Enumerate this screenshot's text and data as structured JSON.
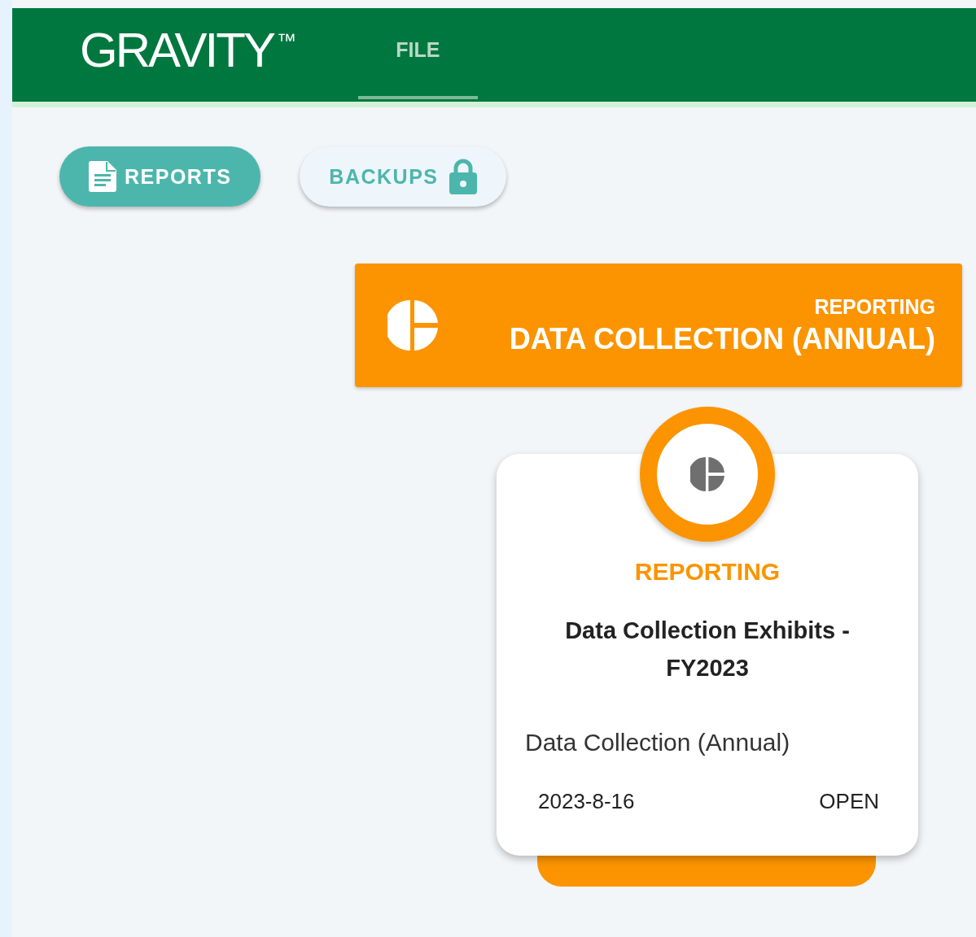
{
  "header": {
    "logo": "GRAVITY",
    "trademark": "™",
    "tabs": [
      {
        "label": "FILE",
        "selected": true
      }
    ]
  },
  "nav_buttons": [
    {
      "label": "REPORTS",
      "selected": true,
      "locked": false
    },
    {
      "label": "BACKUPS",
      "selected": false,
      "locked": true
    }
  ],
  "banner": {
    "category": "REPORTING",
    "title": "DATA COLLECTION (ANNUAL)"
  },
  "card": {
    "category": "REPORTING",
    "title": "Data Collection Exhibits - FY2023",
    "subtitle": "Data Collection (Annual)",
    "date": "2023-8-16",
    "status": "OPEN"
  }
}
